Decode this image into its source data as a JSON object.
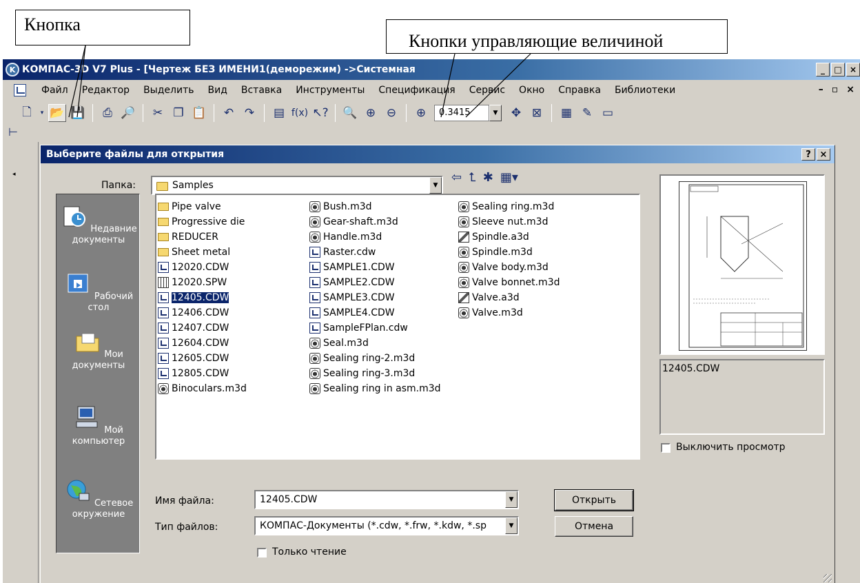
{
  "annotations": {
    "callout_button": "Кнопка",
    "callout_zoom": "Кнопки  управляющие величиной"
  },
  "app": {
    "title": "КОМПАС-3D V7 Plus - [Чертеж БЕЗ ИМЕНИ1(деморежим) ->Системная",
    "menu": [
      "Файл",
      "Редактор",
      "Выделить",
      "Вид",
      "Вставка",
      "Инструменты",
      "Спецификация",
      "Сервис",
      "Окно",
      "Справка",
      "Библиотеки"
    ],
    "zoom_value": "0.3415"
  },
  "dialog": {
    "title": "Выберите файлы для открытия",
    "folder_label": "Папка:",
    "folder_value": "Samples",
    "places": [
      {
        "label": "Недавние документы",
        "icon": "recent-documents-icon"
      },
      {
        "label": "Рабочий стол",
        "icon": "desktop-icon"
      },
      {
        "label": "Мои документы",
        "icon": "my-documents-icon"
      },
      {
        "label": "Мой компьютер",
        "icon": "my-computer-icon"
      },
      {
        "label": "Сетевое окружение",
        "icon": "network-icon"
      }
    ],
    "files": {
      "col1": [
        {
          "name": "Pipe valve",
          "type": "folder"
        },
        {
          "name": "Progressive die",
          "type": "folder"
        },
        {
          "name": "REDUCER",
          "type": "folder"
        },
        {
          "name": "Sheet metal",
          "type": "folder"
        },
        {
          "name": "12020.CDW",
          "type": "cdw"
        },
        {
          "name": "12020.SPW",
          "type": "spw"
        },
        {
          "name": "12405.CDW",
          "type": "cdw",
          "selected": true
        },
        {
          "name": "12406.CDW",
          "type": "cdw"
        },
        {
          "name": "12407.CDW",
          "type": "cdw"
        },
        {
          "name": "12604.CDW",
          "type": "cdw"
        },
        {
          "name": "12605.CDW",
          "type": "cdw"
        },
        {
          "name": "12805.CDW",
          "type": "cdw"
        },
        {
          "name": "Binoculars.m3d",
          "type": "m3d"
        }
      ],
      "col2": [
        {
          "name": "Bush.m3d",
          "type": "m3d"
        },
        {
          "name": "Gear-shaft.m3d",
          "type": "m3d"
        },
        {
          "name": "Handle.m3d",
          "type": "m3d"
        },
        {
          "name": "Raster.cdw",
          "type": "cdw"
        },
        {
          "name": "SAMPLE1.CDW",
          "type": "cdw"
        },
        {
          "name": "SAMPLE2.CDW",
          "type": "cdw"
        },
        {
          "name": "SAMPLE3.CDW",
          "type": "cdw"
        },
        {
          "name": "SAMPLE4.CDW",
          "type": "cdw"
        },
        {
          "name": "SampleFPlan.cdw",
          "type": "cdw"
        },
        {
          "name": "Seal.m3d",
          "type": "m3d"
        },
        {
          "name": "Sealing ring-2.m3d",
          "type": "m3d"
        },
        {
          "name": "Sealing ring-3.m3d",
          "type": "m3d"
        },
        {
          "name": "Sealing ring in asm.m3d",
          "type": "m3d"
        }
      ],
      "col3": [
        {
          "name": "Sealing ring.m3d",
          "type": "m3d"
        },
        {
          "name": "Sleeve nut.m3d",
          "type": "m3d"
        },
        {
          "name": "Spindle.a3d",
          "type": "a3d"
        },
        {
          "name": "Spindle.m3d",
          "type": "m3d"
        },
        {
          "name": "Valve body.m3d",
          "type": "m3d"
        },
        {
          "name": "Valve bonnet.m3d",
          "type": "m3d"
        },
        {
          "name": "Valve.a3d",
          "type": "a3d"
        },
        {
          "name": "Valve.m3d",
          "type": "m3d"
        }
      ]
    },
    "preview_filename": "12405.CDW",
    "disable_preview_label": "Выключить просмотр",
    "filename_label": "Имя файла:",
    "filename_value": "12405.CDW",
    "filetype_label": "Тип файлов:",
    "filetype_value": "КОМПАС-Документы (*.cdw, *.frw, *.kdw, *.sp",
    "readonly_label": "Только чтение",
    "open_button": "Открыть",
    "cancel_button": "Отмена"
  }
}
